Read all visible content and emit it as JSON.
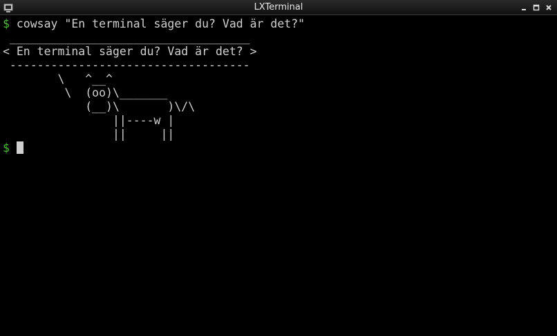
{
  "window": {
    "title": "LXTerminal",
    "icon": "terminal-icon",
    "buttons": {
      "minimize": "minimize-icon",
      "maximize": "maximize-icon",
      "close": "close-icon"
    }
  },
  "colors": {
    "background": "#000000",
    "text": "#d0d0d0",
    "prompt": "#4fbf3a"
  },
  "terminal": {
    "prompt_symbol": "$",
    "command": " cowsay \"En terminal säger du? Vad är det?\"",
    "output": [
      " ___________________________________",
      "< En terminal säger du? Vad är det? >",
      " -----------------------------------",
      "        \\   ^__^",
      "         \\  (oo)\\_______",
      "            (__)\\       )\\/\\",
      "                ||----w |",
      "                ||     ||"
    ],
    "cursor_line_prompt": "$",
    "cursor_line_input": " "
  }
}
